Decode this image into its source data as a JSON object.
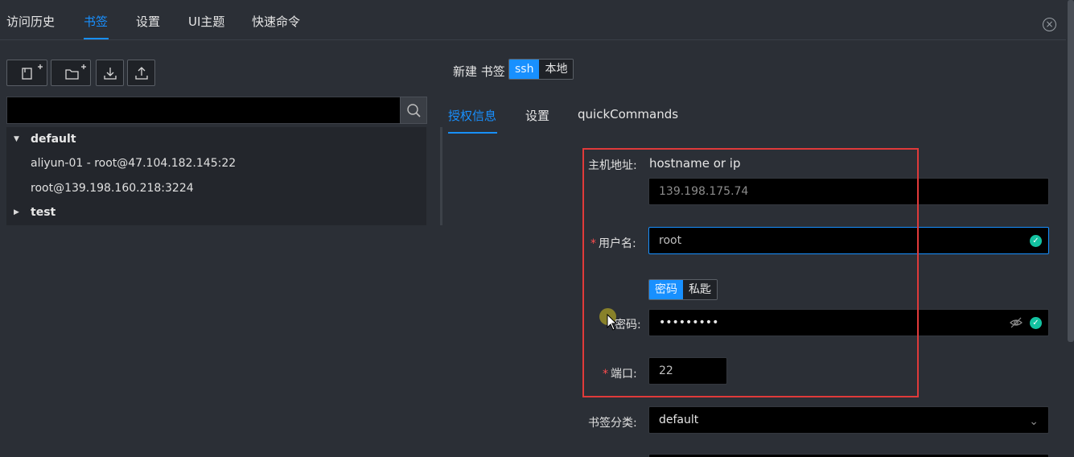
{
  "top_tabs": [
    "访问历史",
    "书签",
    "设置",
    "UI主题",
    "快速命令"
  ],
  "close_icon": "×",
  "toolbar": {
    "new_bookmark_icon": "new-bookmark-icon",
    "new_folder_icon": "new-folder-icon",
    "import_icon": "import-icon",
    "export_icon": "export-icon",
    "search_icon": "search-icon"
  },
  "tree": {
    "groups": [
      {
        "label": "default",
        "expanded": true,
        "items": [
          "aliyun-01 - root@47.104.182.145:22",
          "root@139.198.160.218:3224"
        ]
      },
      {
        "label": "test",
        "expanded": false,
        "items": []
      }
    ]
  },
  "editor": {
    "title": "新建 书签",
    "type_options": [
      "ssh",
      "本地"
    ],
    "sub_tabs": [
      "授权信息",
      "设置",
      "quickCommands"
    ],
    "host_label": "主机地址:",
    "host_hint": "hostname or ip",
    "host_value": "139.198.175.74",
    "username_label": "用户名:",
    "username_value": "root",
    "auth_options": [
      "密码",
      "私匙"
    ],
    "password_label": "密码:",
    "password_value": "•••••••••",
    "port_label": "端口:",
    "port_value": "22",
    "category_label": "书签分类:",
    "category_value": "default"
  },
  "colors": {
    "accent": "#1890ff",
    "highlight": "#e03a3a",
    "valid": "#13c2a1"
  }
}
